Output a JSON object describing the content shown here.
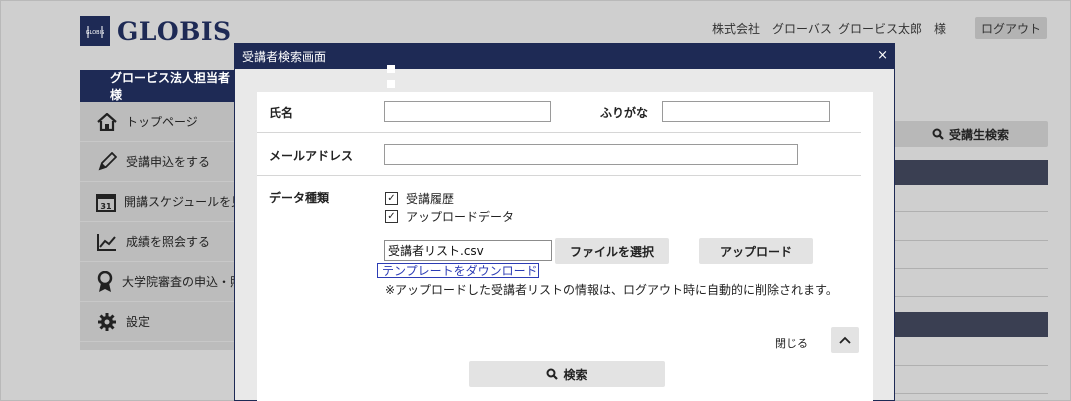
{
  "header": {
    "logo_text": "GLOBIS",
    "company": "株式会社　グローバス",
    "user": "グロービス太郎　様",
    "logout": "ログアウト"
  },
  "sidebar": {
    "title": "グロービス法人担当者様",
    "items": [
      {
        "label": "トップページ",
        "icon": "home-icon"
      },
      {
        "label": "受講申込をする",
        "icon": "pencil-icon"
      },
      {
        "label": "開講スケジュールを見",
        "icon": "calendar-icon"
      },
      {
        "label": "成績を照会する",
        "icon": "chart-icon"
      },
      {
        "label": "大学院審査の申込・照",
        "icon": "award-icon"
      },
      {
        "label": "設定",
        "icon": "gear-icon"
      }
    ]
  },
  "right_panel": {
    "search_button": "受講生検索"
  },
  "modal": {
    "title": "受講者検索画面",
    "close_symbol": "×",
    "name_label": "氏名",
    "name_value": "",
    "furigana_label": "ふりがな",
    "furigana_value": "",
    "email_label": "メールアドレス",
    "email_value": "",
    "data_type_label": "データ種類",
    "data_types": [
      {
        "label": "受講履歴",
        "checked": true
      },
      {
        "label": "アップロードデータ",
        "checked": true
      }
    ],
    "file_value": "受講者リスト.csv",
    "choose_file_button": "ファイルを選択",
    "upload_button": "アップロード",
    "template_link": "テンプレートをダウンロード",
    "note": "※アップロードした受講者リストの情報は、ログアウト時に自動的に削除されます。",
    "close_label": "閉じる",
    "search_button": "検索"
  }
}
